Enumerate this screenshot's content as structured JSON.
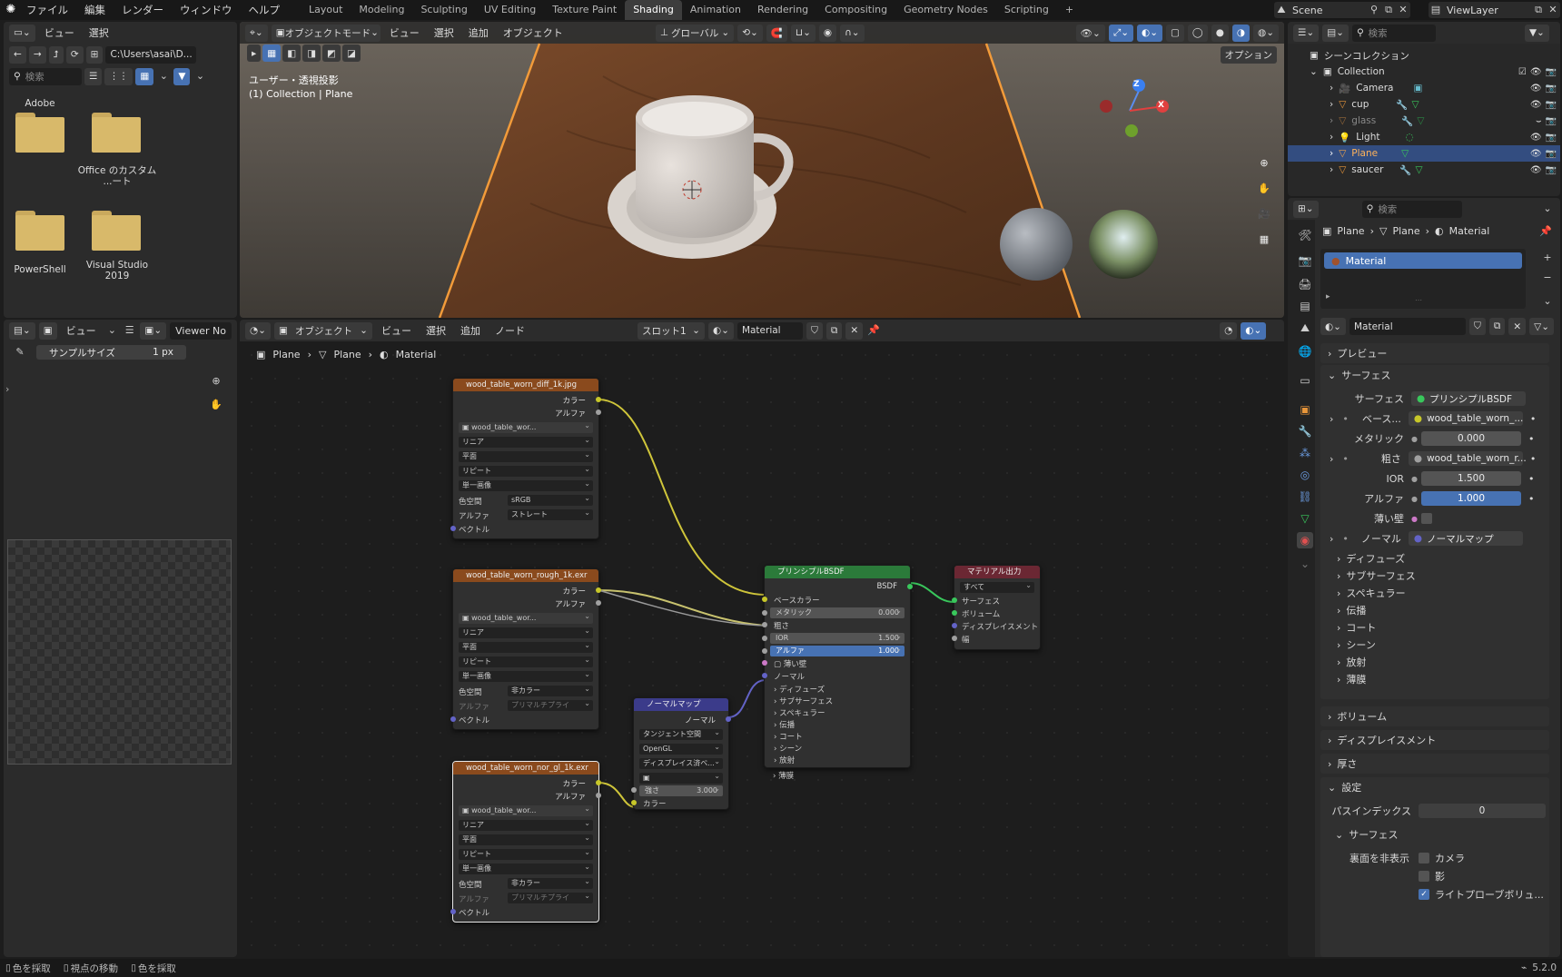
{
  "topbar": {
    "menus": [
      "ファイル",
      "編集",
      "レンダー",
      "ウィンドウ",
      "ヘルプ"
    ],
    "workspaces": [
      "Layout",
      "Modeling",
      "Sculpting",
      "UV Editing",
      "Texture Paint",
      "Shading",
      "Animation",
      "Rendering",
      "Compositing",
      "Geometry Nodes",
      "Scripting"
    ],
    "active_workspace": "Shading",
    "add_tab": "+",
    "scene": "Scene",
    "view_layer": "ViewLayer"
  },
  "filebrowser": {
    "menus": [
      "ビュー",
      "選択"
    ],
    "path": "C:\\Users\\asai\\D...",
    "search_placeholder": "検索",
    "folders": [
      {
        "name": "Adobe"
      },
      {
        "name": "Office のカスタム ...ート"
      },
      {
        "name": "PowerShell"
      },
      {
        "name": "Visual Studio 2019"
      }
    ]
  },
  "image_editor": {
    "menu_view": "ビュー",
    "viewer": "Viewer No",
    "sample_label": "サンプルサイズ",
    "sample_value": "1 px"
  },
  "viewport": {
    "mode": "オブジェクトモード",
    "menus": [
      "ビュー",
      "選択",
      "追加",
      "オブジェクト"
    ],
    "transform": "グローバル",
    "options": "オプション",
    "view_label": "ユーザー・透視投影",
    "collection_label": "(1) Collection | Plane",
    "gizmo": {
      "z": "Z",
      "x": "X"
    }
  },
  "node_editor": {
    "mode": "オブジェクト",
    "menus": [
      "ビュー",
      "選択",
      "追加",
      "ノード"
    ],
    "slot": "スロット1",
    "material": "Material",
    "breadcrumb": [
      "Plane",
      "Plane",
      "Material"
    ],
    "nodes": {
      "tex1": {
        "title": "wood_table_worn_diff_1k.jpg",
        "out_color": "カラー",
        "out_alpha": "アルファ",
        "image": "wood_table_wor...",
        "interp": "リニア",
        "proj": "平面",
        "ext": "リピート",
        "src": "単一画像",
        "cs_label": "色空間",
        "cs_value": "sRGB",
        "alpha_label": "アルファ",
        "alpha_value": "ストレート",
        "vector": "ベクトル"
      },
      "tex2": {
        "title": "wood_table_worn_rough_1k.exr",
        "out_color": "カラー",
        "out_alpha": "アルファ",
        "image": "wood_table_wor...",
        "interp": "リニア",
        "proj": "平面",
        "ext": "リピート",
        "src": "単一画像",
        "cs_label": "色空間",
        "cs_value": "非カラー",
        "alpha_label": "アルファ",
        "alpha_value": "プリマルチプライ",
        "vector": "ベクトル"
      },
      "tex3": {
        "title": "wood_table_worn_nor_gl_1k.exr",
        "out_color": "カラー",
        "out_alpha": "アルファ",
        "image": "wood_table_wor...",
        "interp": "リニア",
        "proj": "平面",
        "ext": "リピート",
        "src": "単一画像",
        "cs_label": "色空間",
        "cs_value": "非カラー",
        "alpha_label": "アルファ",
        "alpha_value": "プリマルチプライ",
        "vector": "ベクトル"
      },
      "normal": {
        "title": "ノーマルマップ",
        "out": "ノーマル",
        "space": "タンジェント空間",
        "format": "OpenGL",
        "displace": "ディスプレイス済ベ...",
        "strength_label": "強さ",
        "strength_value": "3.000",
        "color": "カラー"
      },
      "bsdf": {
        "title": "プリンシプルBSDF",
        "out": "BSDF",
        "base": "ベースカラー",
        "metal_label": "メタリック",
        "metal_value": "0.000",
        "rough": "粗さ",
        "ior_label": "IOR",
        "ior_value": "1.500",
        "alpha_label": "アルファ",
        "alpha_value": "1.000",
        "thin": "薄い壁",
        "normal": "ノーマル",
        "subs": [
          "ディフューズ",
          "サブサーフェス",
          "スペキュラー",
          "伝播",
          "コート",
          "シーン",
          "放射",
          "薄膜"
        ]
      },
      "output": {
        "title": "マテリアル出力",
        "target": "すべて",
        "inputs": [
          "サーフェス",
          "ボリューム",
          "ディスプレイスメント",
          "幅"
        ]
      }
    }
  },
  "outliner": {
    "search_placeholder": "検索",
    "root": "シーンコレクション",
    "collection": "Collection",
    "items": [
      {
        "name": "Camera",
        "selected": false,
        "dim": false
      },
      {
        "name": "cup",
        "selected": false,
        "dim": false
      },
      {
        "name": "glass",
        "selected": false,
        "dim": true
      },
      {
        "name": "Light",
        "selected": false,
        "dim": false
      },
      {
        "name": "Plane",
        "selected": true,
        "dim": false
      },
      {
        "name": "saucer",
        "selected": false,
        "dim": false
      }
    ]
  },
  "properties": {
    "search_placeholder": "検索",
    "breadcrumb": [
      "Plane",
      "Plane",
      "Material"
    ],
    "slot_material": "Material",
    "material_name": "Material",
    "preview": "プレビュー",
    "surface_section": "サーフェス",
    "surface_label": "サーフェス",
    "surface_value": "プリンシプルBSDF",
    "base_label": "ベース...",
    "base_value": "wood_table_worn_...",
    "metal_label": "メタリック",
    "metal_value": "0.000",
    "rough_label": "粗さ",
    "rough_value": "wood_table_worn_r...",
    "ior_label": "IOR",
    "ior_value": "1.500",
    "alpha_label": "アルファ",
    "alpha_value": "1.000",
    "thin_label": "薄い壁",
    "normal_label": "ノーマル",
    "normal_value": "ノーマルマップ",
    "subsections": [
      "ディフューズ",
      "サブサーフェス",
      "スペキュラー",
      "伝播",
      "コート",
      "シーン",
      "放射",
      "薄膜"
    ],
    "volume": "ボリューム",
    "displacement": "ディスプレイスメント",
    "thickness": "厚さ",
    "settings": "設定",
    "pass_index_label": "パスインデックス",
    "pass_index_value": "0",
    "surface_sub": "サーフェス",
    "backface_label": "裏面を非表示",
    "camera": "カメラ",
    "shadow": "影",
    "lightprobe": "ライトプローブボリュ..."
  },
  "statusbar": {
    "items": [
      "色を採取",
      "視点の移動",
      "色を採取"
    ],
    "version": "5.2.0"
  }
}
